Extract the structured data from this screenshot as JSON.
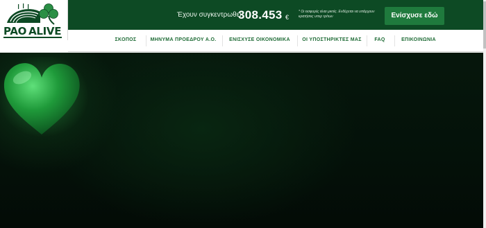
{
  "brand": {
    "logo_text_left": "PAO",
    "logo_text_right": "ALIVE",
    "colors": {
      "primary": "#0d4a24",
      "accent": "#1f7a3d",
      "nav_text": "#1e6b35"
    }
  },
  "topbar": {
    "raised_label": "Έχουν συγκεντρωθεί",
    "raised_amount": "308.453",
    "currency": "€",
    "note": "* Οι εισφορές είναι μικτές. Ενδέχεται να υπάρχουν κρατήσεις υπερ τρίτων",
    "donate_label": "Ενίσχυσε εδώ"
  },
  "nav": {
    "items": [
      {
        "label": "ΣΚΟΠΟΣ"
      },
      {
        "label": "ΜΗΝΥΜΑ ΠΡΟΕΔΡΟΥ Α.Ο."
      },
      {
        "label": "ΕΝΙΣΧΥΣΕ ΟΙΚΟΝΟΜΙΚΑ"
      },
      {
        "label": "ΟΙ ΥΠΟΣΤΗΡΙΚΤΕΣ ΜΑΣ"
      },
      {
        "label": "FAQ"
      },
      {
        "label": "ΕΠΙΚΟΙΝΩΝΙΑ"
      }
    ]
  },
  "hero": {
    "icon": "green-heart-icon"
  }
}
